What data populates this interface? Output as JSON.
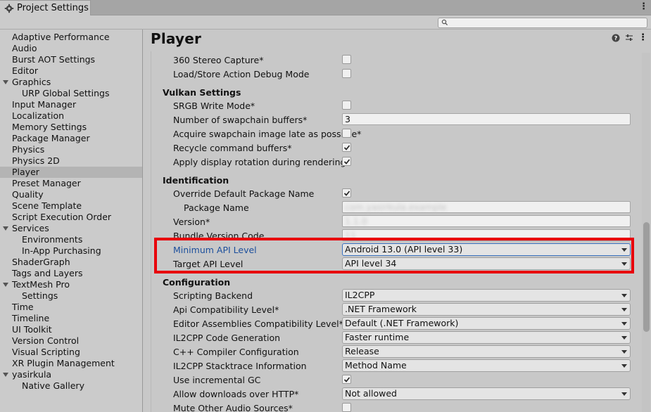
{
  "window": {
    "tab_title": "Project Settings",
    "tab_icon": "gear-icon"
  },
  "search": {
    "placeholder": "",
    "icon": "search-icon"
  },
  "sidebar": {
    "items": [
      {
        "label": "Adaptive Performance",
        "level": 0
      },
      {
        "label": "Audio",
        "level": 0
      },
      {
        "label": "Burst AOT Settings",
        "level": 0
      },
      {
        "label": "Editor",
        "level": 0
      },
      {
        "label": "Graphics",
        "level": 0,
        "expanded": true
      },
      {
        "label": "URP Global Settings",
        "level": 1
      },
      {
        "label": "Input Manager",
        "level": 0
      },
      {
        "label": "Localization",
        "level": 0
      },
      {
        "label": "Memory Settings",
        "level": 0
      },
      {
        "label": "Package Manager",
        "level": 0
      },
      {
        "label": "Physics",
        "level": 0
      },
      {
        "label": "Physics 2D",
        "level": 0
      },
      {
        "label": "Player",
        "level": 0,
        "selected": true
      },
      {
        "label": "Preset Manager",
        "level": 0
      },
      {
        "label": "Quality",
        "level": 0
      },
      {
        "label": "Scene Template",
        "level": 0
      },
      {
        "label": "Script Execution Order",
        "level": 0
      },
      {
        "label": "Services",
        "level": 0,
        "expanded": true
      },
      {
        "label": "Environments",
        "level": 1
      },
      {
        "label": "In-App Purchasing",
        "level": 1
      },
      {
        "label": "ShaderGraph",
        "level": 0
      },
      {
        "label": "Tags and Layers",
        "level": 0
      },
      {
        "label": "TextMesh Pro",
        "level": 0,
        "expanded": true
      },
      {
        "label": "Settings",
        "level": 1
      },
      {
        "label": "Time",
        "level": 0
      },
      {
        "label": "Timeline",
        "level": 0
      },
      {
        "label": "UI Toolkit",
        "level": 0
      },
      {
        "label": "Version Control",
        "level": 0
      },
      {
        "label": "Visual Scripting",
        "level": 0
      },
      {
        "label": "XR Plugin Management",
        "level": 0
      },
      {
        "label": "yasirkula",
        "level": 0,
        "expanded": true
      },
      {
        "label": "Native Gallery",
        "level": 1
      }
    ]
  },
  "main": {
    "title": "Player",
    "header_icons": [
      "help-icon",
      "preset-icon",
      "more-icon"
    ],
    "rows": {
      "stereo_capture": {
        "label": "360 Stereo Capture*",
        "checked": false
      },
      "load_store_debug": {
        "label": "Load/Store Action Debug Mode",
        "checked": false
      },
      "vulkan_header": "Vulkan Settings",
      "srgb_write": {
        "label": "SRGB Write Mode*",
        "checked": false
      },
      "swapchain_buffers": {
        "label": "Number of swapchain buffers*",
        "value": "3"
      },
      "acquire_swapchain": {
        "label": "Acquire swapchain image late as possible*",
        "checked": false
      },
      "recycle_buffers": {
        "label": "Recycle command buffers*",
        "checked": true
      },
      "display_rotation": {
        "label": "Apply display rotation during rendering",
        "checked": true
      },
      "identification_header": "Identification",
      "override_package": {
        "label": "Override Default Package Name",
        "checked": true
      },
      "package_name": {
        "label": "Package Name",
        "value": "com.yasirkula.example"
      },
      "version": {
        "label": "Version*",
        "value": "1.1.0"
      },
      "bundle_version": {
        "label": "Bundle Version Code",
        "value": "11"
      },
      "min_api": {
        "label": "Minimum API Level",
        "value": "Android 13.0 (API level 33)"
      },
      "target_api": {
        "label": "Target API Level",
        "value": "API level 34"
      },
      "configuration_header": "Configuration",
      "scripting_backend": {
        "label": "Scripting Backend",
        "value": "IL2CPP"
      },
      "api_compat": {
        "label": "Api Compatibility Level*",
        "value": ".NET Framework"
      },
      "editor_assemblies": {
        "label": "Editor Assemblies Compatibility Level*",
        "value": "Default (.NET Framework)"
      },
      "il2cpp_codegen": {
        "label": "IL2CPP Code Generation",
        "value": "Faster runtime"
      },
      "cpp_compiler": {
        "label": "C++ Compiler Configuration",
        "value": "Release"
      },
      "stacktrace": {
        "label": "IL2CPP Stacktrace Information",
        "value": "Method Name"
      },
      "incremental_gc": {
        "label": "Use incremental GC",
        "checked": true
      },
      "http_downloads": {
        "label": "Allow downloads over HTTP*",
        "value": "Not allowed"
      },
      "mute_audio": {
        "label": "Mute Other Audio Sources*",
        "checked": false
      }
    }
  },
  "colors": {
    "highlight": "#e8000b",
    "link_label": "#1c4f9c",
    "selected_row": "#b4b4b4"
  }
}
